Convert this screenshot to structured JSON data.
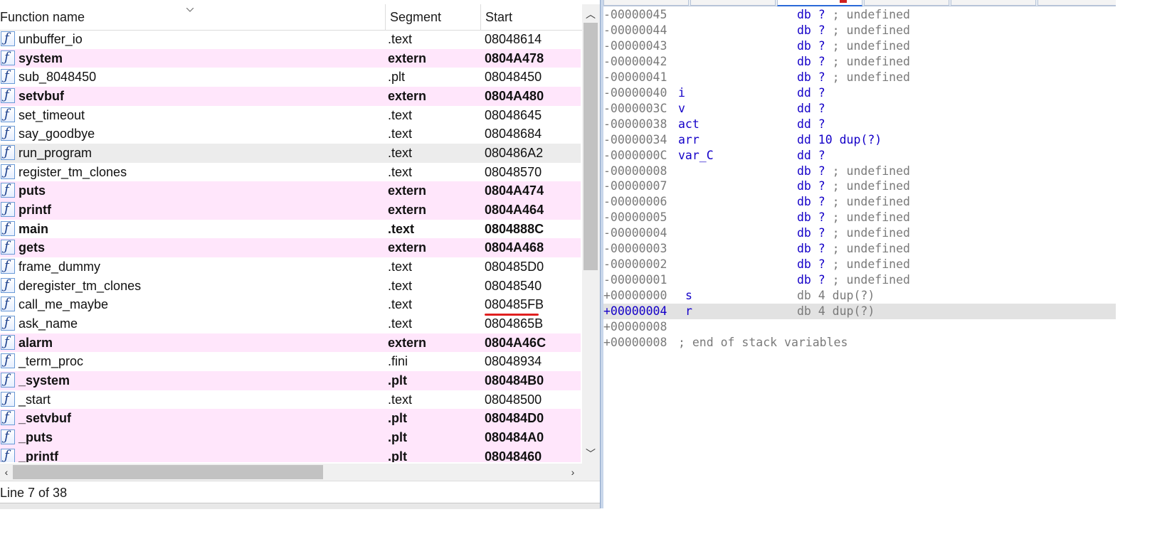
{
  "function_list": {
    "columns": {
      "name": "Function name",
      "segment": "Segment",
      "start": "Start"
    },
    "rows": [
      {
        "name": "unbuffer_io",
        "segment": ".text",
        "start": "08048614",
        "style": "normal"
      },
      {
        "name": "system",
        "segment": "extern",
        "start": "0804A478",
        "style": "import"
      },
      {
        "name": "sub_8048450",
        "segment": ".plt",
        "start": "08048450",
        "style": "normal"
      },
      {
        "name": "setvbuf",
        "segment": "extern",
        "start": "0804A480",
        "style": "import"
      },
      {
        "name": "set_timeout",
        "segment": ".text",
        "start": "08048645",
        "style": "normal"
      },
      {
        "name": "say_goodbye",
        "segment": ".text",
        "start": "08048684",
        "style": "normal"
      },
      {
        "name": "run_program",
        "segment": ".text",
        "start": "080486A2",
        "style": "selected"
      },
      {
        "name": "register_tm_clones",
        "segment": ".text",
        "start": "08048570",
        "style": "normal"
      },
      {
        "name": "puts",
        "segment": "extern",
        "start": "0804A474",
        "style": "import"
      },
      {
        "name": "printf",
        "segment": "extern",
        "start": "0804A464",
        "style": "import"
      },
      {
        "name": "main",
        "segment": ".text",
        "start": "0804888C",
        "style": "bold"
      },
      {
        "name": "gets",
        "segment": "extern",
        "start": "0804A468",
        "style": "import"
      },
      {
        "name": "frame_dummy",
        "segment": ".text",
        "start": "080485D0",
        "style": "normal"
      },
      {
        "name": "deregister_tm_clones",
        "segment": ".text",
        "start": "08048540",
        "style": "normal"
      },
      {
        "name": "call_me_maybe",
        "segment": ".text",
        "start": "080485FB",
        "style": "normal",
        "underlined": true
      },
      {
        "name": "ask_name",
        "segment": ".text",
        "start": "0804865B",
        "style": "normal"
      },
      {
        "name": "alarm",
        "segment": "extern",
        "start": "0804A46C",
        "style": "import"
      },
      {
        "name": "_term_proc",
        "segment": ".fini",
        "start": "08048934",
        "style": "normal"
      },
      {
        "name": "_system",
        "segment": ".plt",
        "start": "080484B0",
        "style": "import"
      },
      {
        "name": "_start",
        "segment": ".text",
        "start": "08048500",
        "style": "normal"
      },
      {
        "name": "_setvbuf",
        "segment": ".plt",
        "start": "080484D0",
        "style": "import"
      },
      {
        "name": "_puts",
        "segment": ".plt",
        "start": "080484A0",
        "style": "import"
      },
      {
        "name": "_printf",
        "segment": ".plt",
        "start": "08048460",
        "style": "import"
      }
    ],
    "status": "Line 7 of 38",
    "colors": {
      "import_row_bg": "#ffe6fb",
      "selected_row_bg": "#ececec",
      "underline": "#e02020"
    }
  },
  "stack_view": {
    "rows": [
      {
        "offset": "-00000045",
        "name": "",
        "decl": "db ? ; undefined",
        "kind": "undef"
      },
      {
        "offset": "-00000044",
        "name": "",
        "decl": "db ? ; undefined",
        "kind": "undef"
      },
      {
        "offset": "-00000043",
        "name": "",
        "decl": "db ? ; undefined",
        "kind": "undef"
      },
      {
        "offset": "-00000042",
        "name": "",
        "decl": "db ? ; undefined",
        "kind": "undef"
      },
      {
        "offset": "-00000041",
        "name": "",
        "decl": "db ? ; undefined",
        "kind": "undef"
      },
      {
        "offset": "-00000040",
        "name": "i",
        "decl": "dd ?",
        "kind": "var"
      },
      {
        "offset": "-0000003C",
        "name": "v",
        "decl": "dd ?",
        "kind": "var"
      },
      {
        "offset": "-00000038",
        "name": "act",
        "decl": "dd ?",
        "kind": "var"
      },
      {
        "offset": "-00000034",
        "name": "arr",
        "decl": "dd 10 dup(?)",
        "kind": "var"
      },
      {
        "offset": "-0000000C",
        "name": "var_C",
        "decl": "dd ?",
        "kind": "var"
      },
      {
        "offset": "-00000008",
        "name": "",
        "decl": "db ? ; undefined",
        "kind": "undef"
      },
      {
        "offset": "-00000007",
        "name": "",
        "decl": "db ? ; undefined",
        "kind": "undef"
      },
      {
        "offset": "-00000006",
        "name": "",
        "decl": "db ? ; undefined",
        "kind": "undef"
      },
      {
        "offset": "-00000005",
        "name": "",
        "decl": "db ? ; undefined",
        "kind": "undef"
      },
      {
        "offset": "-00000004",
        "name": "",
        "decl": "db ? ; undefined",
        "kind": "undef"
      },
      {
        "offset": "-00000003",
        "name": "",
        "decl": "db ? ; undefined",
        "kind": "undef"
      },
      {
        "offset": "-00000002",
        "name": "",
        "decl": "db ? ; undefined",
        "kind": "undef"
      },
      {
        "offset": "-00000001",
        "name": "",
        "decl": "db ? ; undefined",
        "kind": "undef"
      },
      {
        "offset": "+00000000",
        "name": "s",
        "decl": "db 4 dup(?)",
        "kind": "special"
      },
      {
        "offset": "+00000004",
        "name": "r",
        "decl": "db 4 dup(?)",
        "kind": "special",
        "highlighted": true
      },
      {
        "offset": "+00000008",
        "name": "",
        "decl": "",
        "kind": "blank"
      },
      {
        "offset": "+00000008",
        "name": "",
        "decl": "",
        "comment": "; end of stack variables",
        "kind": "end"
      }
    ],
    "colors": {
      "keyword": "#1400c8",
      "muted": "#7a7a7a",
      "highlight_row": "#e2e2e2"
    }
  }
}
